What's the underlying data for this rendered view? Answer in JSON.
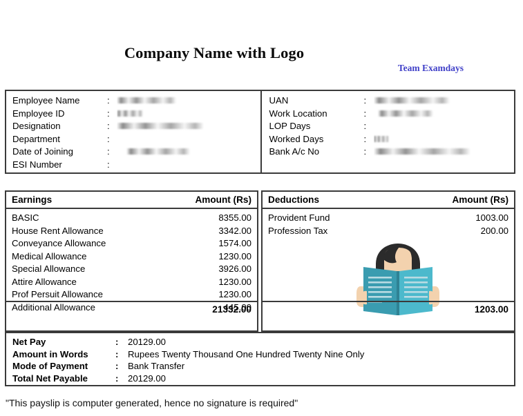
{
  "header": {
    "company_title": "Company Name with Logo",
    "brand": "Team Examdays",
    "brand_color": "#4040c8"
  },
  "employee_details": {
    "left": [
      {
        "label": "Employee Name",
        "colon": ":",
        "value": "",
        "redacted": true
      },
      {
        "label": "Employee ID",
        "colon": ":",
        "value": "",
        "redacted": true
      },
      {
        "label": "Designation",
        "colon": ":",
        "value": "",
        "redacted": true
      },
      {
        "label": "Department",
        "colon": ":",
        "value": "",
        "redacted": false
      },
      {
        "label": "Date of Joining",
        "colon": ":",
        "value": "",
        "redacted": true
      },
      {
        "label": "ESI Number",
        "colon": ":",
        "value": "",
        "redacted": false
      }
    ],
    "right": [
      {
        "label": "UAN",
        "colon": ":",
        "value": "",
        "redacted": true
      },
      {
        "label": "Work Location",
        "colon": ":",
        "value": "",
        "redacted": true
      },
      {
        "label": "LOP Days",
        "colon": ":",
        "value": "",
        "redacted": false
      },
      {
        "label": "Worked Days",
        "colon": ":",
        "value": "",
        "redacted": true
      },
      {
        "label": "Bank A/c No",
        "colon": ":",
        "value": "",
        "redacted": true
      }
    ]
  },
  "earnings": {
    "header_label": "Earnings",
    "header_amount": "Amount (Rs)",
    "rows": [
      {
        "label": "BASIC",
        "amount": "8355.00"
      },
      {
        "label": "House Rent Allowance",
        "amount": "3342.00"
      },
      {
        "label": "Conveyance Allowance",
        "amount": "1574.00"
      },
      {
        "label": "Medical Allowance",
        "amount": "1230.00"
      },
      {
        "label": "Special Allowance",
        "amount": "3926.00"
      },
      {
        "label": "Attire Allowance",
        "amount": "1230.00"
      },
      {
        "label": "Prof Persuit Allowance",
        "amount": "1230.00"
      },
      {
        "label": "Additional Allowance",
        "amount": "445.00"
      }
    ],
    "total": "21332.00"
  },
  "deductions": {
    "header_label": "Deductions",
    "header_amount": "Amount (Rs)",
    "rows": [
      {
        "label": "Provident Fund",
        "amount": "1003.00"
      },
      {
        "label": "Profession Tax",
        "amount": "200.00"
      }
    ],
    "total": "1203.00"
  },
  "illustration": {
    "name": "person-reading-book",
    "hair_color": "#2b2b2b",
    "skin_color": "#f3d2ae",
    "book_left_color": "#3a9cb0",
    "book_right_color": "#4cb9cc",
    "book_line_color": "#b9dbe3"
  },
  "summary": {
    "rows": [
      {
        "label": "Net Pay",
        "colon": ":",
        "value": "20129.00"
      },
      {
        "label": "Amount in Words",
        "colon": ":",
        "value": "Rupees Twenty Thousand One Hundred Twenty Nine Only"
      },
      {
        "label": "Mode of Payment",
        "colon": ":",
        "value": "Bank Transfer"
      },
      {
        "label": "Total Net Payable",
        "colon": ":",
        "value": "20129.00"
      }
    ]
  },
  "footer": {
    "note": "\"This payslip is computer generated, hence no signature is required\""
  }
}
